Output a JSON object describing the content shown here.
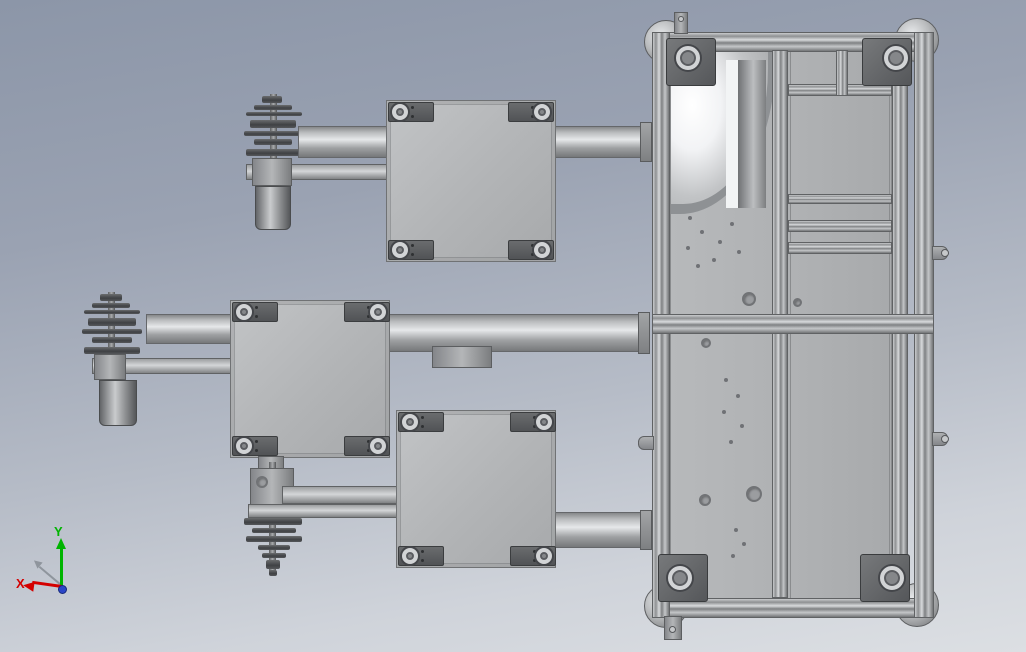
{
  "triad": {
    "x_label": "X",
    "y_label": "Y",
    "x_axis_color": "#d40000",
    "y_axis_color": "#00b400",
    "z_axis_color": "#8f959d",
    "origin_color": "#2b46c8"
  },
  "colors": {
    "background_top": "#8c96a8",
    "background_bottom": "#dcdfe3",
    "plate_gray": "#b2b4b6",
    "rail_gray": "#a9abad",
    "dark_metal": "#515356",
    "highlight": "#f4f6f8"
  },
  "parts": {
    "frame": "wheeled-extrusion-frame",
    "plates": [
      "square-plate-top",
      "square-plate-middle",
      "square-plate-bottom"
    ],
    "spindles": [
      "spindle-motor-top",
      "spindle-motor-middle",
      "spindle-motor-bottom"
    ],
    "caster_count": 4
  }
}
